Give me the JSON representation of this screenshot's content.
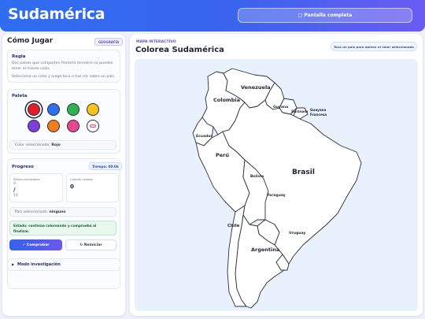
{
  "header": {
    "title": "Sudamérica",
    "fullscreen_icon": "□",
    "fullscreen_label": "Pantalla completa"
  },
  "sidebar": {
    "title": "Cómo Jugar",
    "tag": "GEOGRAFÍA",
    "rules": {
      "title": "Regla",
      "line1": "Dos países que comparten frontera terrestre no pueden",
      "line2": "tener el mismo color.",
      "line3": "Selecciona un color y luego toca o haz clic sobre un país."
    },
    "palette": {
      "title": "Paleta",
      "colors": [
        {
          "name": "red",
          "hex": "#e11d2a"
        },
        {
          "name": "blue",
          "hex": "#2e6ff0"
        },
        {
          "name": "green",
          "hex": "#2fb350"
        },
        {
          "name": "yellow",
          "hex": "#f6c21c"
        },
        {
          "name": "purple",
          "hex": "#7b3fe0"
        },
        {
          "name": "orange",
          "hex": "#f47a1c"
        },
        {
          "name": "pink",
          "hex": "#e9478f"
        },
        {
          "name": "eraser",
          "hex": "#ffffff"
        }
      ],
      "selected_label": "Color seleccionado:",
      "selected_value": "Rojo"
    },
    "progress": {
      "title": "Progreso",
      "timer_label": "Tiempo:",
      "timer_value": "00:06",
      "colored_label": "Países coloreados",
      "colored_value": "0",
      "colored_sep": "/",
      "colored_total": "13",
      "colors_used_label": "Colores usados",
      "colors_used_value": "0",
      "selected_country_label": "País seleccionado:",
      "selected_country_value": "ninguno",
      "status_label": "Estado:",
      "status_value": "continúa coloreando y comprueba al finalizar."
    },
    "buttons": {
      "check_icon": "✓",
      "check": "Comprobar",
      "reset_icon": "↻",
      "reset": "Reiniciar"
    },
    "investigation": {
      "arrow": "▶",
      "label": "Modo investigación"
    }
  },
  "main": {
    "kicker": "MAPA INTERACTIVO",
    "title": "Colorea Sudamérica",
    "hint": "Toca un país para aplicar el color seleccionado",
    "countries": {
      "venezuela": "Venezuela",
      "colombia": "Colombia",
      "guyana": "Guyana",
      "suriname": "Surinam",
      "french_guiana_1": "Guayana",
      "french_guiana_2": "Francesa",
      "ecuador": "Ecuador",
      "peru": "Perú",
      "brazil": "Brasil",
      "bolivia": "Bolivia",
      "paraguay": "Paraguay",
      "chile": "Chile",
      "uruguay": "Uruguay",
      "argentina": "Argentina"
    }
  }
}
